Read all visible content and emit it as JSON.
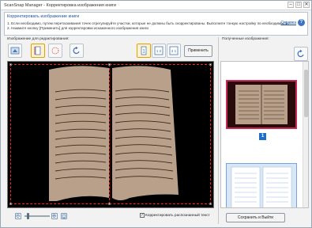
{
  "window": {
    "title": "ScanSnap Manager - Корректировка изображения книги",
    "minimize_glyph": "–",
    "maximize_glyph": "□",
    "close_glyph": "✕"
  },
  "info": {
    "heading": "Корректировать изображение книги",
    "line1": "1. Если необходимо, путем перетаскивания точек отрегулируйте участки, которые не должны быть скорректированы. Выполните тонкую настройку по необходимости.",
    "line2": "2. Нажмите кнопку [Применить] для корректировки искаженного изображения книги",
    "help_link": "Справка",
    "help_icon_glyph": "?"
  },
  "left_panel": {
    "label": "Изображение для редактирования:",
    "apply_label": "Применить",
    "zoom_out_glyph": "−",
    "zoom_in_glyph": "+",
    "zoom_level": 0.1,
    "checkbox_checked": true,
    "checkbox_glyph": "✓",
    "checkbox_label": "Корректировать распознанный текст"
  },
  "right_panel": {
    "label": "Полученные изображения:",
    "page_number": "1",
    "save_label": "Сохранить и Выйти"
  },
  "page_selector": {
    "one": "1",
    "one_two": "1 2",
    "two_one": "2 1"
  },
  "colors": {
    "crop": "#ff2020",
    "page": "#b8a08a",
    "selected": "#c72a53",
    "page_badge": "#1d6fcf"
  },
  "icons": [
    "fit-page-icon",
    "book-mode-icon",
    "crop-mode-icon",
    "rotate-icon",
    "single-page-icon",
    "two-pages-right-icon",
    "two-pages-left-icon",
    "refresh-icon",
    "zoom-out-icon",
    "zoom-in-icon",
    "fit-icon"
  ]
}
